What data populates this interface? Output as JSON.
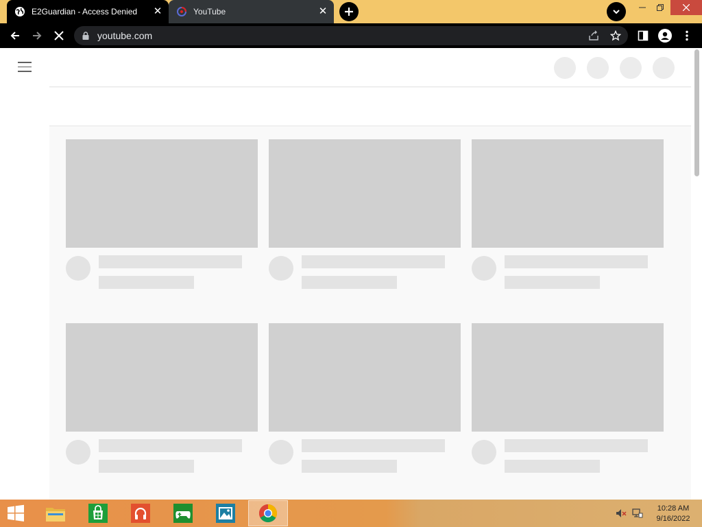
{
  "browser": {
    "tabs": [
      {
        "title": "E2Guardian - Access Denied",
        "active": true
      },
      {
        "title": "YouTube",
        "active": false
      }
    ],
    "address": "youtube.com",
    "accent": "#f3c76a"
  },
  "taskbar": {
    "clock_time": "10:28 AM",
    "clock_date": "9/16/2022",
    "apps": [
      "start-icon",
      "file-explorer-icon",
      "store-icon",
      "music-icon",
      "games-icon",
      "photos-icon",
      "chrome-icon"
    ]
  }
}
